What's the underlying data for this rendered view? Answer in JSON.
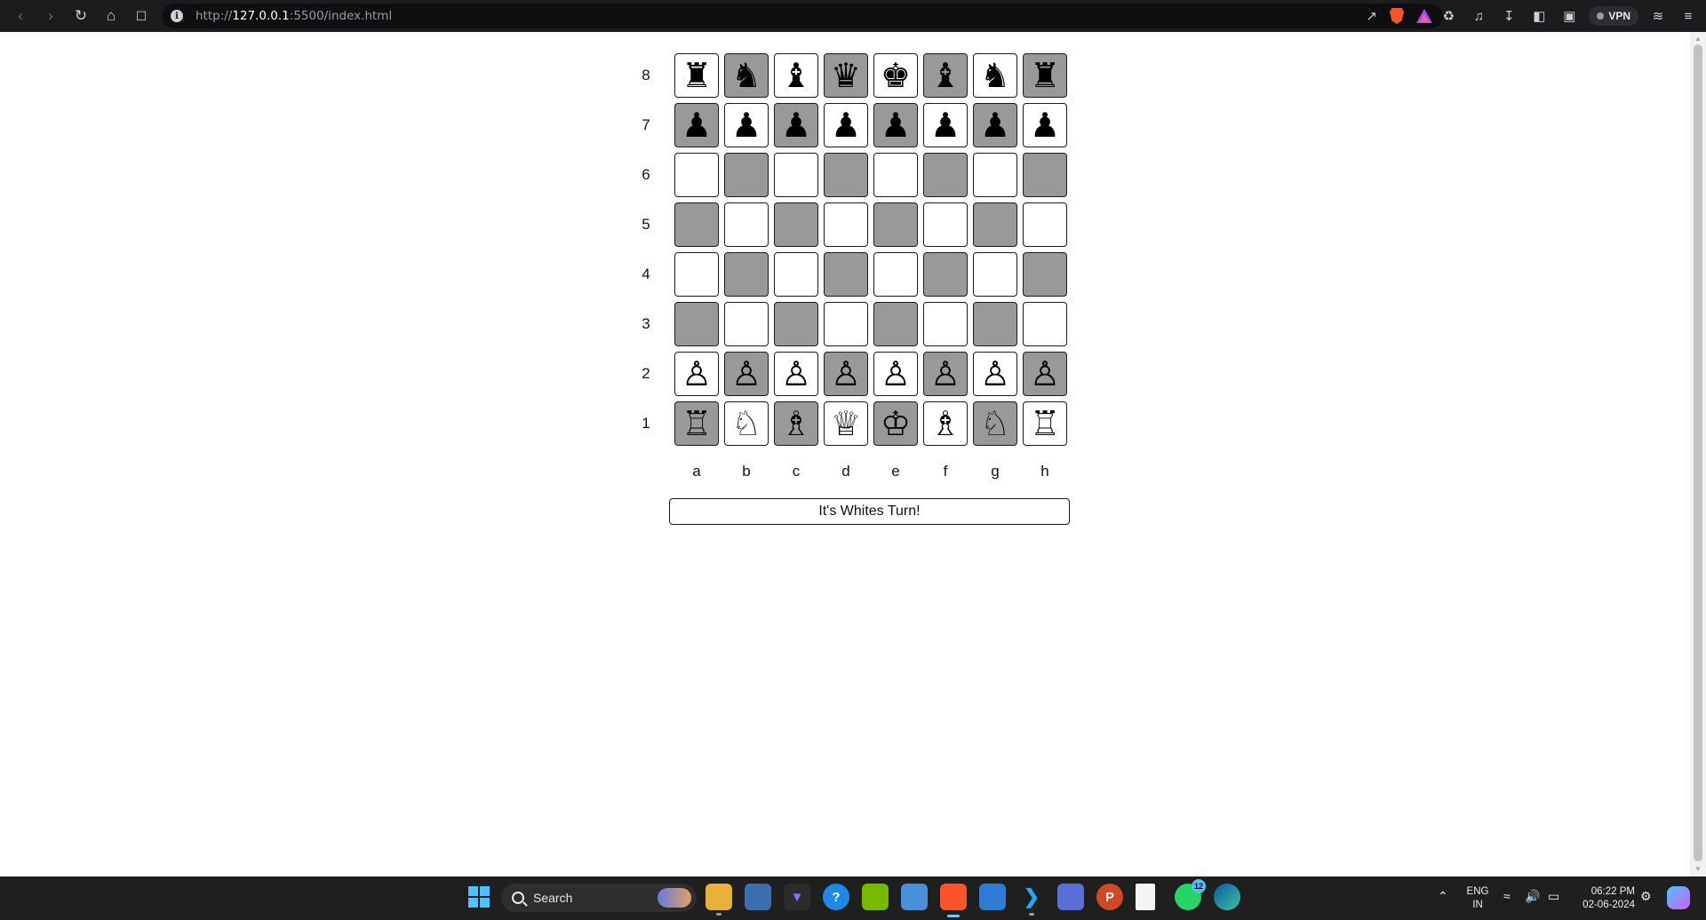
{
  "browser": {
    "url_scheme": "http://",
    "url_host": "127.0.0.1",
    "url_path": ":5500/index.html",
    "vpn_label": "VPN"
  },
  "board": {
    "ranks": [
      "8",
      "7",
      "6",
      "5",
      "4",
      "3",
      "2",
      "1"
    ],
    "files": [
      "a",
      "b",
      "c",
      "d",
      "e",
      "f",
      "g",
      "h"
    ],
    "squares": [
      [
        "♜",
        "♞",
        "♝",
        "♛",
        "♚",
        "♝",
        "♞",
        "♜"
      ],
      [
        "♟",
        "♟",
        "♟",
        "♟",
        "♟",
        "♟",
        "♟",
        "♟"
      ],
      [
        "",
        "",
        "",
        "",
        "",
        "",
        "",
        ""
      ],
      [
        "",
        "",
        "",
        "",
        "",
        "",
        "",
        ""
      ],
      [
        "",
        "",
        "",
        "",
        "",
        "",
        "",
        ""
      ],
      [
        "",
        "",
        "",
        "",
        "",
        "",
        "",
        ""
      ],
      [
        "♙",
        "♙",
        "♙",
        "♙",
        "♙",
        "♙",
        "♙",
        "♙"
      ],
      [
        "♖",
        "♘",
        "♗",
        "♕",
        "♔",
        "♗",
        "♘",
        "♖"
      ]
    ],
    "light_color": "#ffffff",
    "dark_color": "#999999"
  },
  "status": {
    "message": "It's Whites Turn!"
  },
  "taskbar": {
    "search_label": "Search",
    "whatsapp_badge": "12",
    "language_line1": "ENG",
    "language_line2": "IN",
    "time": "06:22 PM",
    "date": "02-06-2024"
  }
}
